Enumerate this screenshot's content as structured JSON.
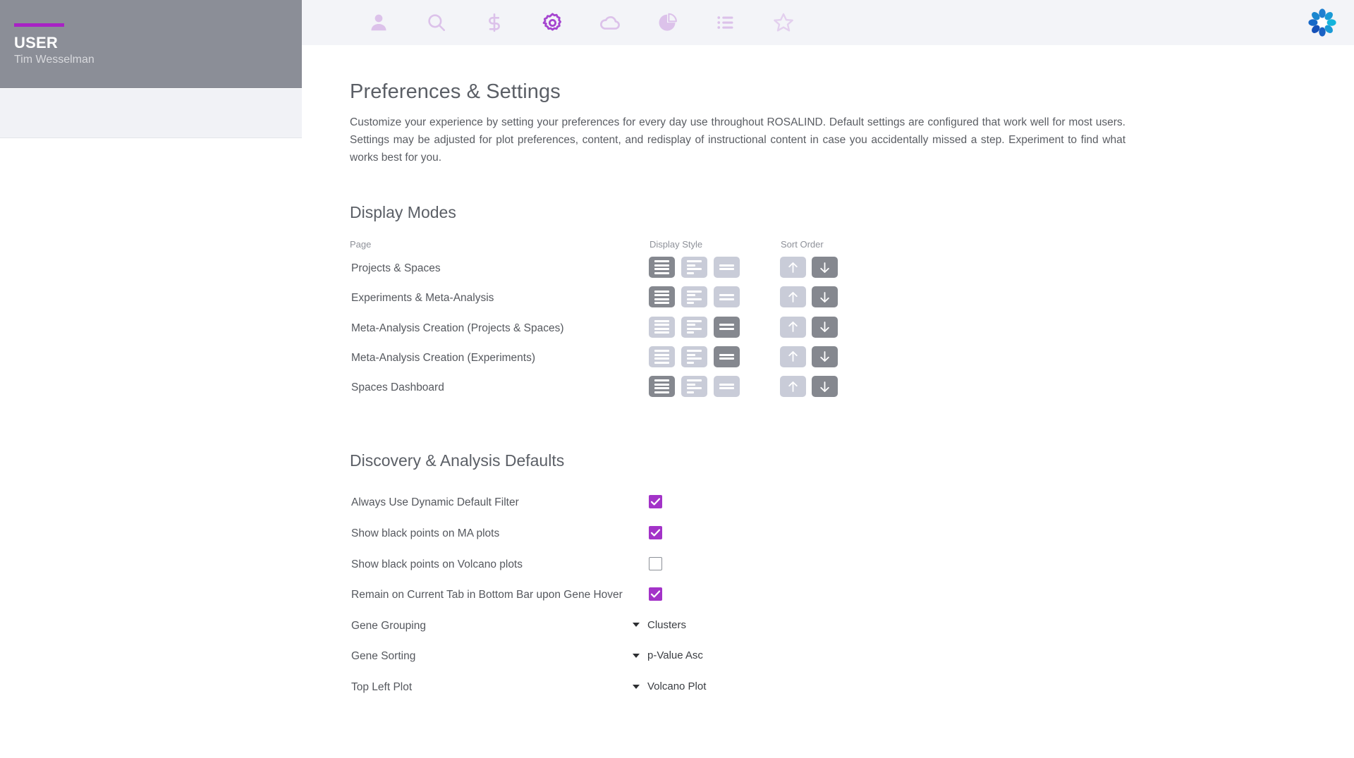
{
  "sidebar": {
    "accent_color": "#a822c4",
    "title": "USER",
    "user_name": "Tim Wesselman"
  },
  "topnav": {
    "items": [
      {
        "icon": "person-icon",
        "label": "Profile",
        "active": false
      },
      {
        "icon": "search-icon",
        "label": "Search",
        "active": false
      },
      {
        "icon": "dollar-icon",
        "label": "Billing",
        "active": false
      },
      {
        "icon": "gear-icon",
        "label": "Settings",
        "active": true
      },
      {
        "icon": "cloud-icon",
        "label": "Cloud",
        "active": false
      },
      {
        "icon": "pie-chart-icon",
        "label": "Reports",
        "active": false
      },
      {
        "icon": "list-icon",
        "label": "Lists",
        "active": false
      },
      {
        "icon": "star-icon",
        "label": "Favorites",
        "active": false
      }
    ],
    "brand_logo": "rosalind-logo",
    "active_color": "#a545d0",
    "inactive_color": "#dcc2ea"
  },
  "page": {
    "title": "Preferences & Settings",
    "description": "Customize your experience by setting your preferences for every day use throughout ROSALIND. Default settings are configured that work well for most users. Settings may be adjusted for plot preferences, content, and redisplay of instructional content in case you accidentally missed a step. Experiment to find what works best for you."
  },
  "display_modes": {
    "section_title": "Display Modes",
    "columns": {
      "page": "Page",
      "display_style": "Display Style",
      "sort_order": "Sort Order"
    },
    "style_options": [
      "full",
      "compact",
      "minimal"
    ],
    "sort_options": [
      "ascending",
      "descending"
    ],
    "rows": [
      {
        "page": "Projects & Spaces",
        "display_style": 0,
        "sort_order": 1
      },
      {
        "page": "Experiments & Meta-Analysis",
        "display_style": 0,
        "sort_order": 1
      },
      {
        "page": "Meta-Analysis Creation (Projects & Spaces)",
        "display_style": 2,
        "sort_order": 1
      },
      {
        "page": "Meta-Analysis Creation (Experiments)",
        "display_style": 2,
        "sort_order": 1
      },
      {
        "page": "Spaces Dashboard",
        "display_style": 0,
        "sort_order": 1
      }
    ]
  },
  "discovery_defaults": {
    "section_title": "Discovery & Analysis Defaults",
    "checkbox_color": "#a333c8",
    "checkboxes": [
      {
        "label": "Always Use Dynamic Default Filter",
        "checked": true
      },
      {
        "label": "Show black points on MA plots",
        "checked": true
      },
      {
        "label": "Show black points on Volcano plots",
        "checked": false
      },
      {
        "label": "Remain on Current Tab in Bottom Bar upon Gene Hover",
        "checked": true
      }
    ],
    "selects": [
      {
        "label": "Gene Grouping",
        "value": "Clusters"
      },
      {
        "label": "Gene Sorting",
        "value": "p-Value Asc"
      },
      {
        "label": "Top Left Plot",
        "value": "Volcano Plot"
      }
    ]
  }
}
